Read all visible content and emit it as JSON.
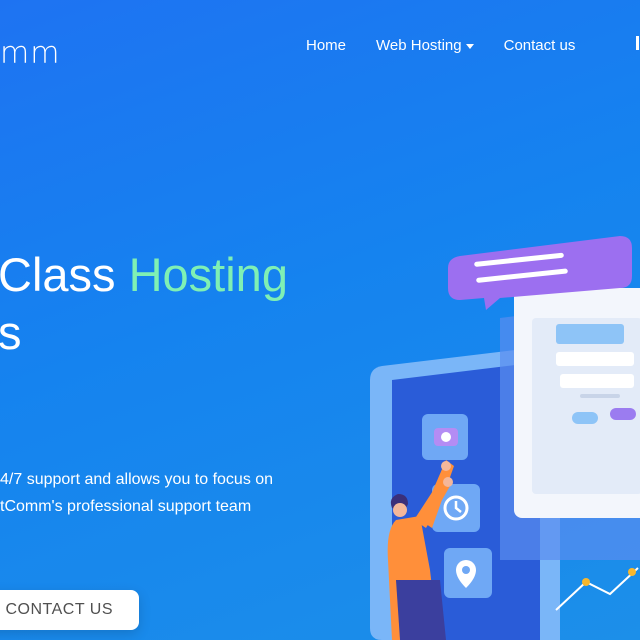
{
  "brand": {
    "logo_text": "mm"
  },
  "nav": {
    "items": [
      {
        "label": "Home"
      },
      {
        "label": "Web Hosting"
      },
      {
        "label": "Contact us"
      }
    ]
  },
  "hero": {
    "title_part1": "Class ",
    "title_accent": "Hosting",
    "title_line2": "s",
    "description_line1": "4/7 support and allows you to focus on",
    "description_line2": "tComm's professional support team",
    "cta_label": "CONTACT US"
  },
  "colors": {
    "background_start": "#1e73f2",
    "background_end": "#1c8fe9",
    "accent_text": "#7ff0b4",
    "cta_background": "#ffffff",
    "cta_text": "#505050"
  },
  "icons": [
    "caret-down-icon",
    "camera-icon",
    "clock-icon",
    "location-pin-icon"
  ]
}
